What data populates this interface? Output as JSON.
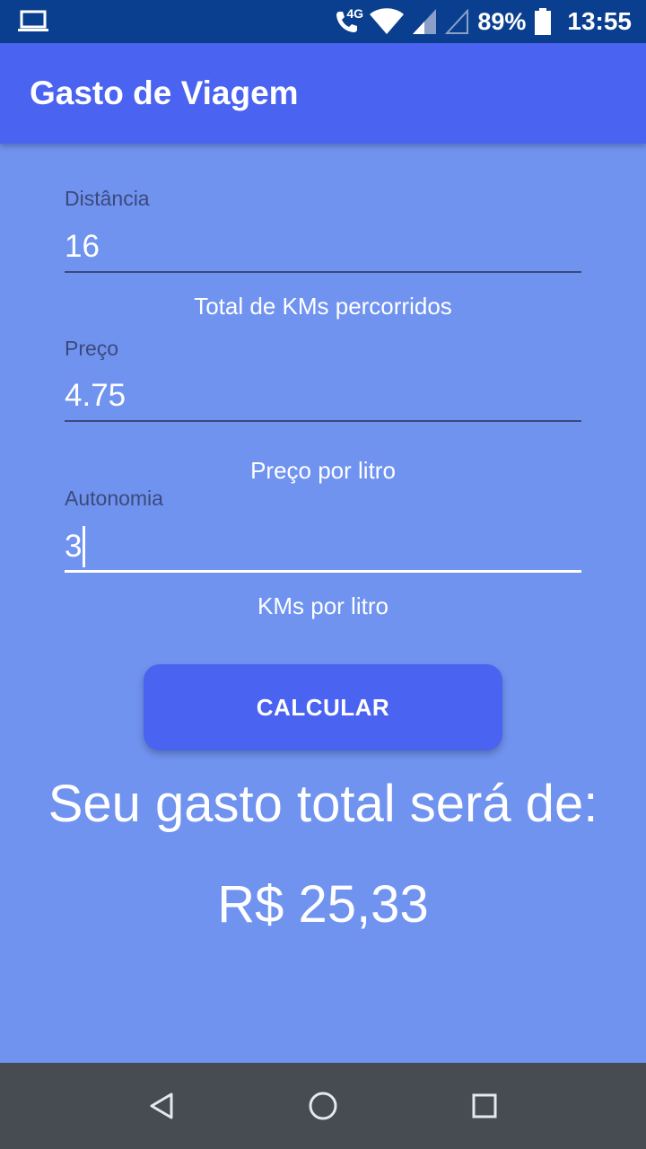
{
  "status_bar": {
    "network": "4G",
    "battery": "89%",
    "time": "13:55"
  },
  "app_bar": {
    "title": "Gasto de Viagem"
  },
  "form": {
    "distance": {
      "label": "Distância",
      "value": "16",
      "helper": "Total de KMs percorridos"
    },
    "price": {
      "label": "Preço",
      "value": "4.75",
      "helper": "Preço por litro"
    },
    "autonomy": {
      "label": "Autonomia",
      "value": "3",
      "helper": "KMs por litro"
    },
    "calculate_label": "CALCULAR"
  },
  "result": {
    "title": "Seu gasto total será de:",
    "value": "R$ 25,33"
  },
  "icons": {
    "laptop": "laptop-icon",
    "call": "wifi-call-icon",
    "wifi": "wifi-icon",
    "signal1": "signal-icon",
    "signal2": "signal-empty-icon",
    "battery": "battery-icon",
    "back": "back-icon",
    "home": "home-icon",
    "recents": "recents-icon"
  },
  "colors": {
    "status_bar": "#0a3f8f",
    "app_bar": "#4a63f0",
    "background": "#7093f0",
    "button": "#4a63f0",
    "nav_bar": "#464c52"
  }
}
